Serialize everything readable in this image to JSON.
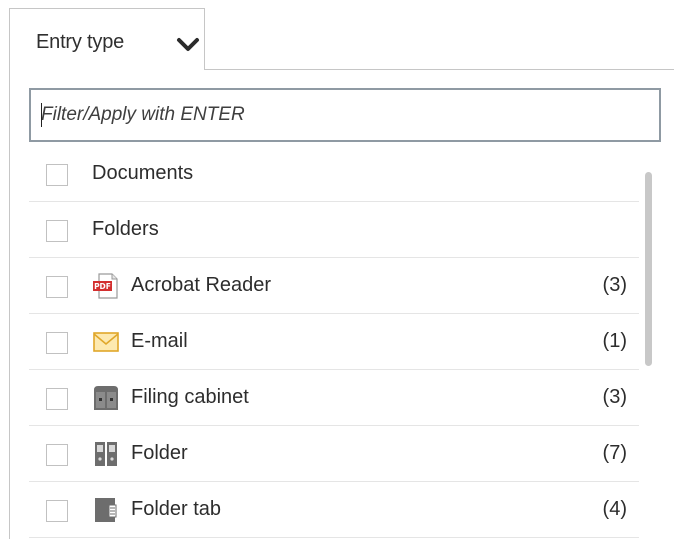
{
  "tab": {
    "label": "Entry type",
    "icon": "chevron-down-icon"
  },
  "filter": {
    "value": "",
    "placeholder": "Filter/Apply with ENTER"
  },
  "items": [
    {
      "label": "Documents",
      "count": "",
      "icon": null,
      "checked": false
    },
    {
      "label": "Folders",
      "count": "",
      "icon": null,
      "checked": false
    },
    {
      "label": "Acrobat Reader",
      "count": "(3)",
      "icon": "pdf-icon",
      "icon_text": "PDF",
      "checked": false
    },
    {
      "label": "E-mail",
      "count": "(1)",
      "icon": "email-icon",
      "checked": false
    },
    {
      "label": "Filing cabinet",
      "count": "(3)",
      "icon": "filing-cabinet-icon",
      "checked": false
    },
    {
      "label": "Folder",
      "count": "(7)",
      "icon": "folder-binder-icon",
      "checked": false
    },
    {
      "label": "Folder tab",
      "count": "(4)",
      "icon": "folder-tab-icon",
      "checked": false
    }
  ],
  "colors": {
    "pdf_red": "#d32f2f",
    "email_yellow": "#f5c451",
    "icon_gray": "#6d6d6d",
    "border": "#c6c6c6",
    "input_border": "#8f9aa3"
  }
}
